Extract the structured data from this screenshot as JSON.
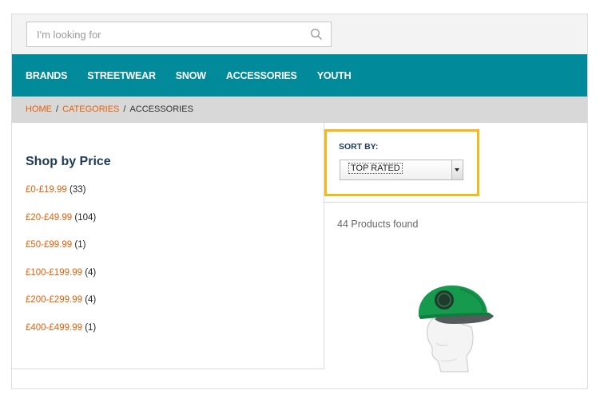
{
  "search": {
    "placeholder": "I'm looking for",
    "value": "",
    "icon": "search-icon"
  },
  "nav": {
    "items": [
      "BRANDS",
      "STREETWEAR",
      "SNOW",
      "ACCESSORIES",
      "YOUTH"
    ],
    "background": "#008a9a"
  },
  "breadcrumb": {
    "home": "HOME",
    "categories": "CATEGORIES",
    "current": "ACCESSORIES",
    "separator": "/"
  },
  "sidebar": {
    "title": "Shop by Price",
    "prices": [
      {
        "range": "£0-£19.99",
        "count": "(33)"
      },
      {
        "range": "£20-£49.99",
        "count": "(104)"
      },
      {
        "range": "£50-£99.99",
        "count": "(1)"
      },
      {
        "range": "£100-£199.99",
        "count": "(4)"
      },
      {
        "range": "£200-£299.99",
        "count": "(4)"
      },
      {
        "range": "£400-£499.99",
        "count": "(1)"
      }
    ]
  },
  "sort": {
    "label": "SORT BY:",
    "selected": "TOP RATED",
    "highlight": "#f2b81c"
  },
  "results": {
    "count_text": "44 Products found"
  },
  "colors": {
    "link": "#e8600a",
    "heading": "#1d3a5a"
  }
}
